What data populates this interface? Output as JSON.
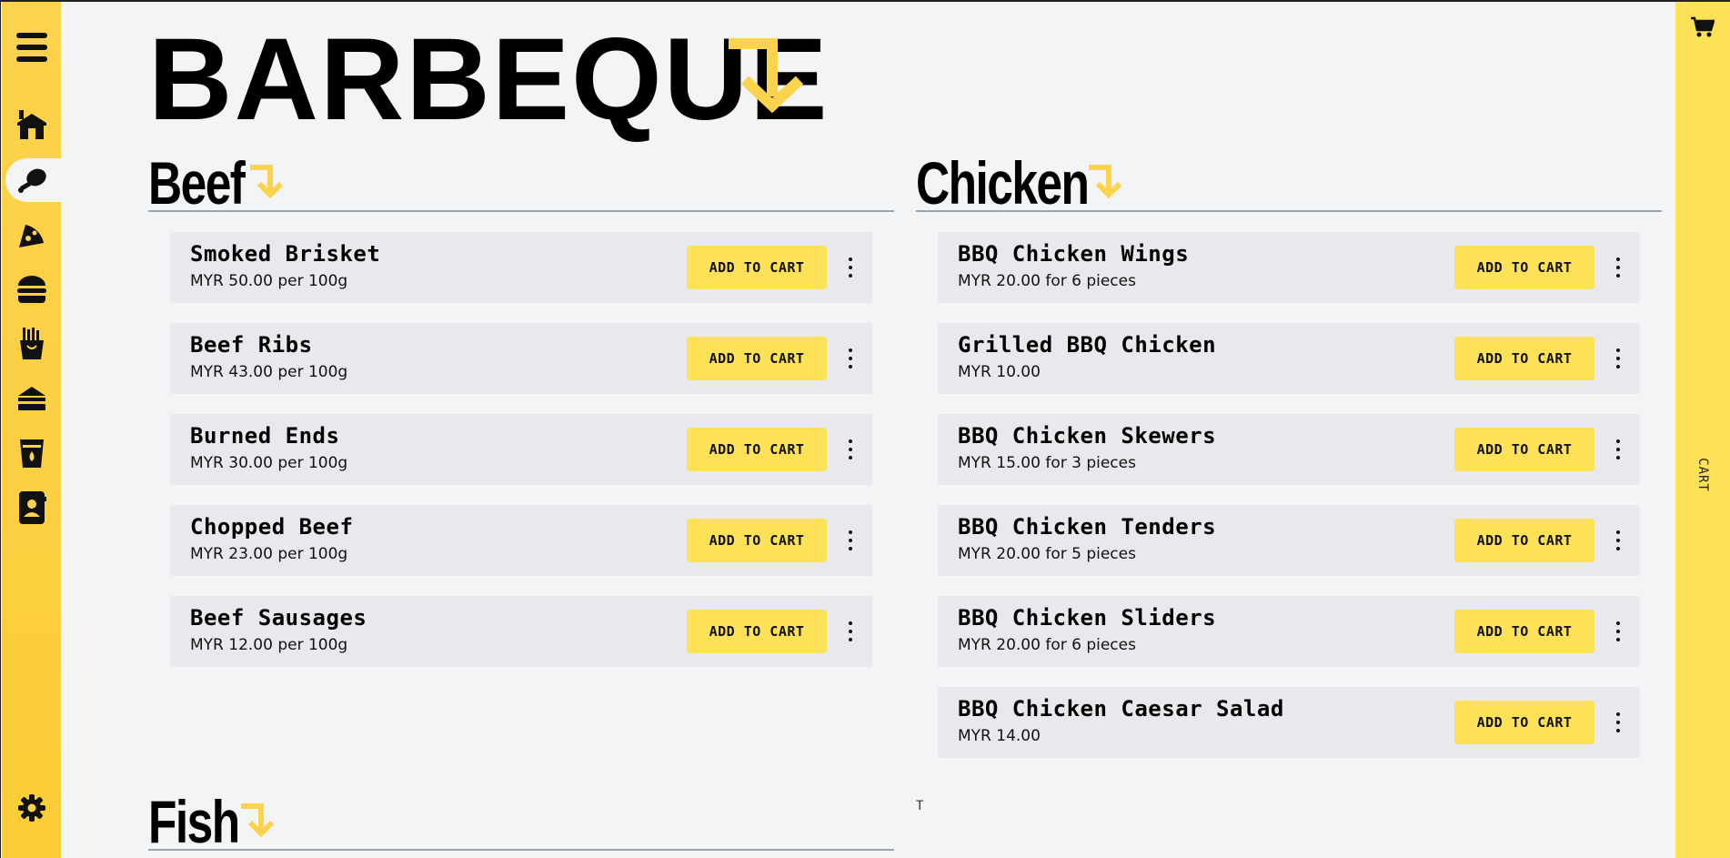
{
  "page": {
    "title": "BARBEQUE"
  },
  "colors": {
    "accent": "#fcd34d",
    "button": "#fde156",
    "arrow": "#fcd34d",
    "background": "#f3f4f6",
    "card": "#e8e9ec"
  },
  "sidebar": {
    "items": [
      {
        "icon": "hamburger-menu-icon"
      },
      {
        "icon": "home-icon"
      },
      {
        "icon": "meat-icon",
        "active": true
      },
      {
        "icon": "pizza-icon"
      },
      {
        "icon": "burger-icon"
      },
      {
        "icon": "fries-icon"
      },
      {
        "icon": "sandwich-icon"
      },
      {
        "icon": "drink-icon"
      },
      {
        "icon": "contact-book-icon"
      },
      {
        "icon": "settings-icon"
      }
    ]
  },
  "cart": {
    "icon": "shopping-cart-icon",
    "label": "CART"
  },
  "button_label": "ADD TO CART",
  "sections": {
    "beef": {
      "title": "Beef",
      "items": [
        {
          "name": "Smoked Brisket",
          "price": "MYR 50.00 per 100g"
        },
        {
          "name": "Beef Ribs",
          "price": "MYR 43.00 per 100g"
        },
        {
          "name": "Burned Ends",
          "price": "MYR 30.00 per 100g"
        },
        {
          "name": "Chopped Beef",
          "price": "MYR 23.00 per 100g"
        },
        {
          "name": "Beef Sausages",
          "price": "MYR 12.00 per 100g"
        }
      ]
    },
    "chicken": {
      "title": "Chicken",
      "items": [
        {
          "name": "BBQ Chicken Wings",
          "price": "MYR 20.00 for 6 pieces"
        },
        {
          "name": "Grilled BBQ Chicken",
          "price": "MYR 10.00"
        },
        {
          "name": "BBQ Chicken Skewers",
          "price": "MYR 15.00 for 3 pieces"
        },
        {
          "name": "BBQ Chicken Tenders",
          "price": "MYR 20.00 for 5 pieces"
        },
        {
          "name": "BBQ Chicken Sliders",
          "price": "MYR 20.00 for 6 pieces"
        },
        {
          "name": "BBQ Chicken Caesar Salad",
          "price": "MYR 14.00"
        }
      ]
    },
    "fish": {
      "title": "Fish"
    }
  },
  "stray_text": "T"
}
